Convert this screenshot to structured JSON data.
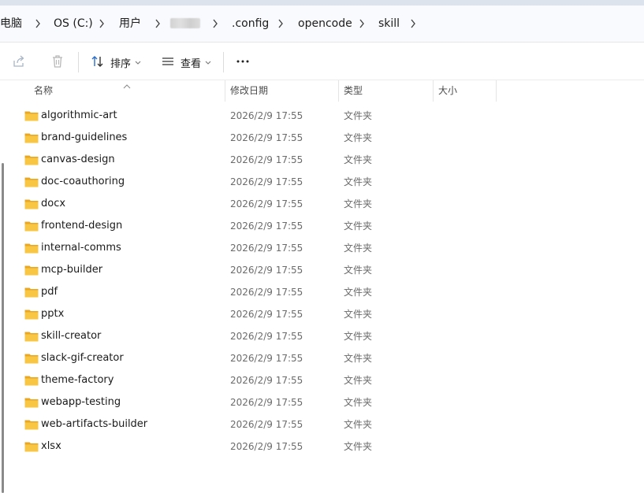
{
  "breadcrumb": {
    "items": [
      "电脑",
      "OS (C:)",
      "用户",
      "",
      ".config",
      "opencode",
      "skill"
    ]
  },
  "toolbar": {
    "sort_label": "排序",
    "view_label": "查看",
    "more_label": "···"
  },
  "columns": {
    "name": "名称",
    "modified": "修改日期",
    "type": "类型",
    "size": "大小"
  },
  "files": [
    {
      "name": "algorithmic-art",
      "modified": "2026/2/9 17:55",
      "type": "文件夹",
      "size": ""
    },
    {
      "name": "brand-guidelines",
      "modified": "2026/2/9 17:55",
      "type": "文件夹",
      "size": ""
    },
    {
      "name": "canvas-design",
      "modified": "2026/2/9 17:55",
      "type": "文件夹",
      "size": ""
    },
    {
      "name": "doc-coauthoring",
      "modified": "2026/2/9 17:55",
      "type": "文件夹",
      "size": ""
    },
    {
      "name": "docx",
      "modified": "2026/2/9 17:55",
      "type": "文件夹",
      "size": ""
    },
    {
      "name": "frontend-design",
      "modified": "2026/2/9 17:55",
      "type": "文件夹",
      "size": ""
    },
    {
      "name": "internal-comms",
      "modified": "2026/2/9 17:55",
      "type": "文件夹",
      "size": ""
    },
    {
      "name": "mcp-builder",
      "modified": "2026/2/9 17:55",
      "type": "文件夹",
      "size": ""
    },
    {
      "name": "pdf",
      "modified": "2026/2/9 17:55",
      "type": "文件夹",
      "size": ""
    },
    {
      "name": "pptx",
      "modified": "2026/2/9 17:55",
      "type": "文件夹",
      "size": ""
    },
    {
      "name": "skill-creator",
      "modified": "2026/2/9 17:55",
      "type": "文件夹",
      "size": ""
    },
    {
      "name": "slack-gif-creator",
      "modified": "2026/2/9 17:55",
      "type": "文件夹",
      "size": ""
    },
    {
      "name": "theme-factory",
      "modified": "2026/2/9 17:55",
      "type": "文件夹",
      "size": ""
    },
    {
      "name": "webapp-testing",
      "modified": "2026/2/9 17:55",
      "type": "文件夹",
      "size": ""
    },
    {
      "name": "web-artifacts-builder",
      "modified": "2026/2/9 17:55",
      "type": "文件夹",
      "size": ""
    },
    {
      "name": "xlsx",
      "modified": "2026/2/9 17:55",
      "type": "文件夹",
      "size": ""
    }
  ],
  "colors": {
    "folder_fill": "#f8c642",
    "folder_tab": "#e8a825",
    "addressbar_bg": "#f9fafd"
  },
  "icons": {
    "share": "share-icon",
    "delete": "delete-icon",
    "sort": "sort-icon",
    "view": "view-icon",
    "folder": "folder-icon"
  }
}
